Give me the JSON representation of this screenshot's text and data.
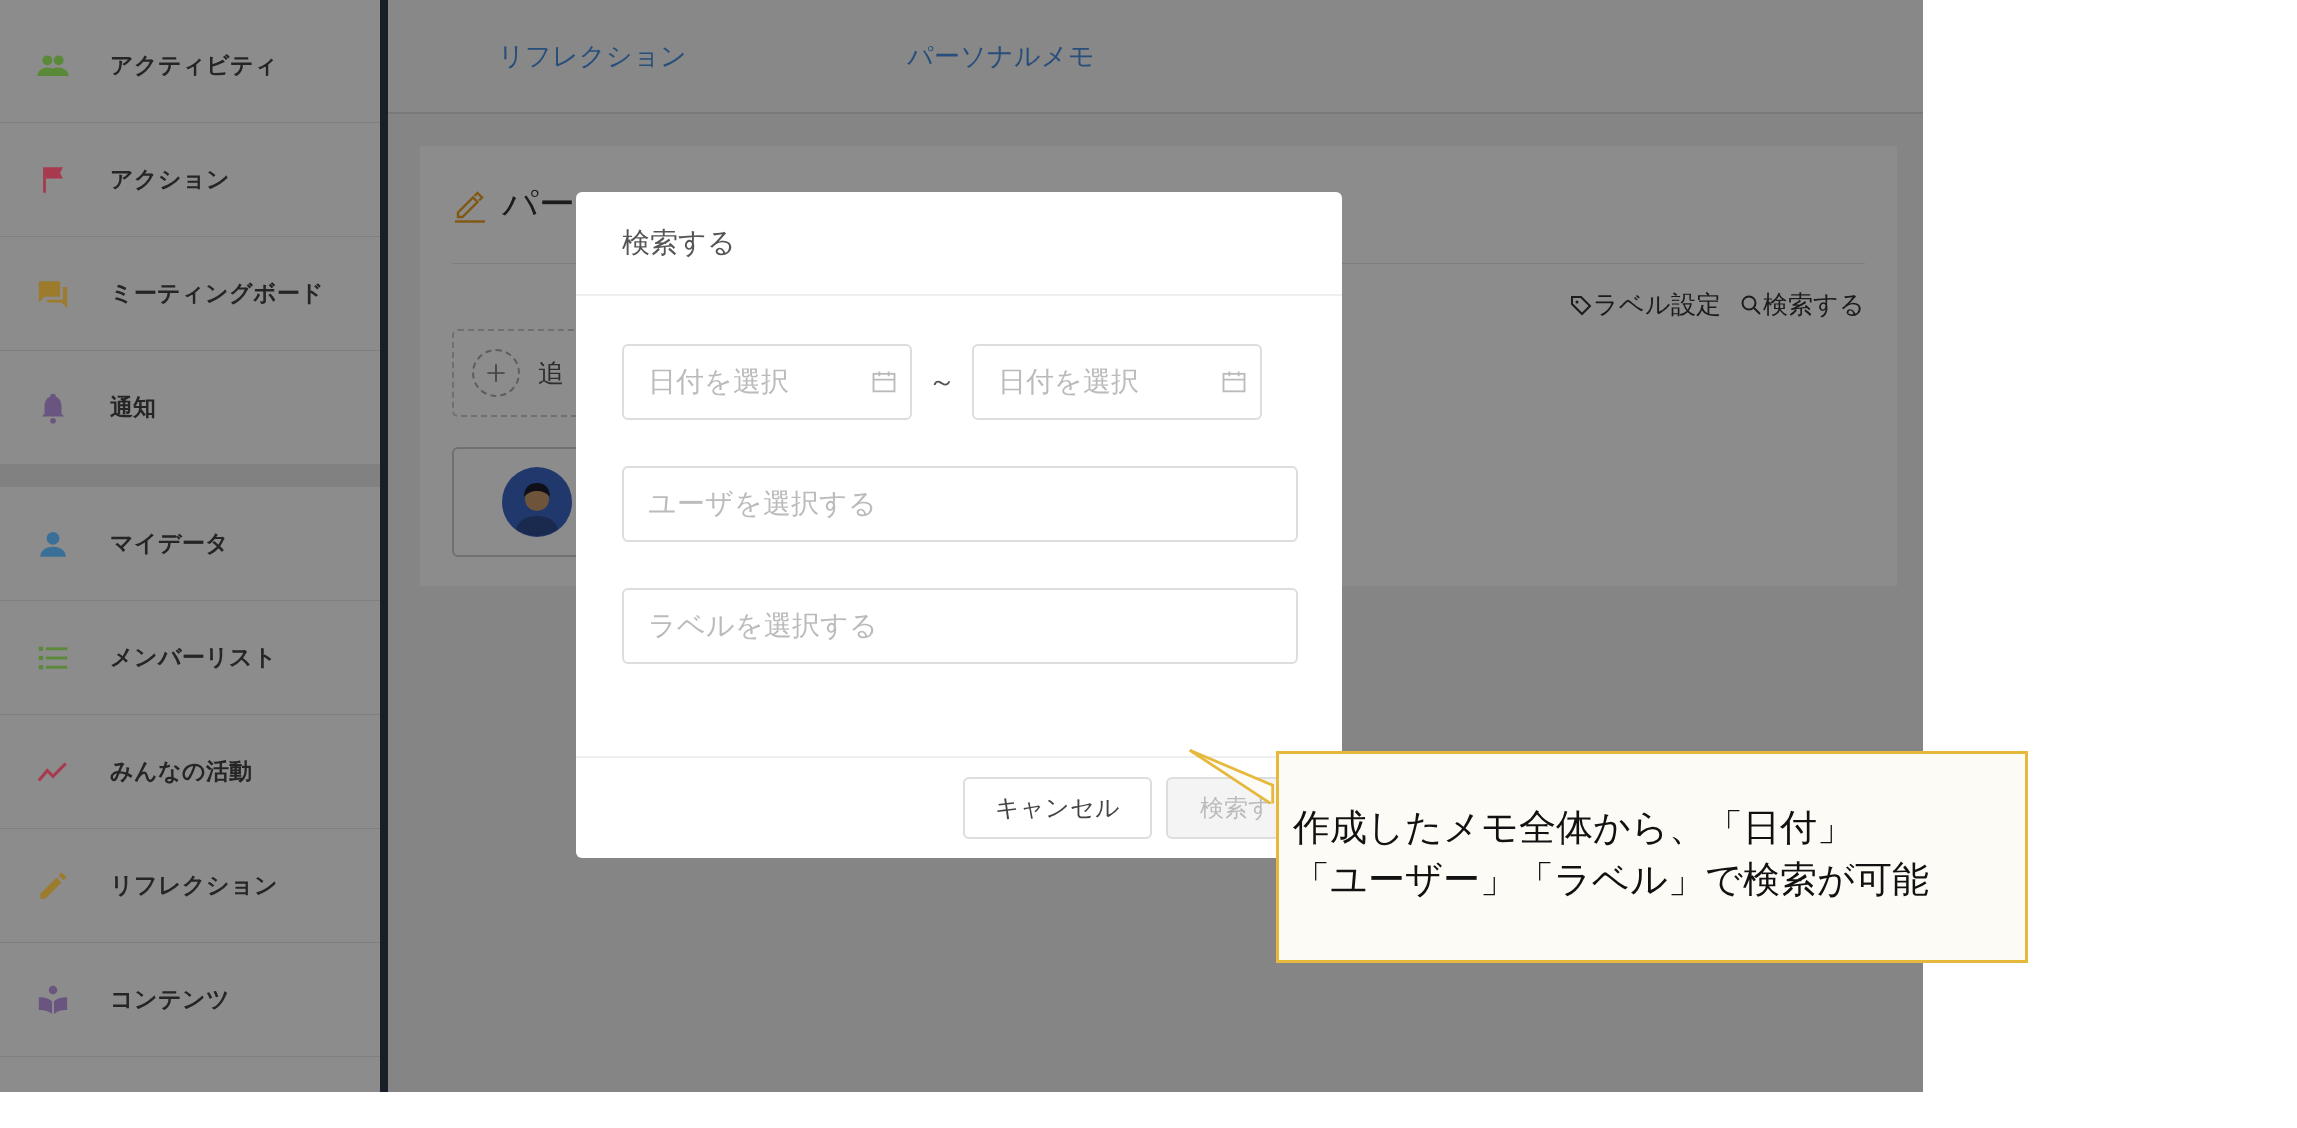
{
  "sidebar": {
    "groups": [
      {
        "items": [
          {
            "label": "アクティビティ",
            "kind": "people",
            "color": "#5a8a38"
          },
          {
            "label": "アクション",
            "kind": "flag",
            "color": "#a83a50"
          },
          {
            "label": "ミーティングボード",
            "kind": "chat",
            "color": "#9c7c2c"
          },
          {
            "label": "通知",
            "kind": "bell",
            "color": "#6a5480"
          }
        ]
      },
      {
        "items": [
          {
            "label": "マイデータ",
            "kind": "person",
            "color": "#3a7098"
          },
          {
            "label": "メンバーリスト",
            "kind": "list",
            "color": "#5a8a38"
          },
          {
            "label": "みんなの活動",
            "kind": "trend",
            "color": "#a83a50"
          },
          {
            "label": "リフレクション",
            "kind": "pencil",
            "color": "#9c7c2c"
          },
          {
            "label": "コンテンツ",
            "kind": "book",
            "color": "#6a5480"
          }
        ]
      }
    ]
  },
  "tabs": [
    {
      "label": "リフレクション"
    },
    {
      "label": "パーソナルメモ"
    }
  ],
  "panel": {
    "title": "パー",
    "tools": [
      {
        "label": "ラベル設定",
        "kind": "tag"
      },
      {
        "label": "検索する",
        "kind": "search"
      }
    ],
    "add_button": "追"
  },
  "dialog": {
    "title": "検索する",
    "date_from": {
      "placeholder": "日付を選択"
    },
    "range_sep": "～",
    "date_to": {
      "placeholder": "日付を選択"
    },
    "user": {
      "placeholder": "ユーザを選択する"
    },
    "label": {
      "placeholder": "ラベルを選択する"
    },
    "buttons": [
      {
        "label": "キャンセル",
        "disabled": false
      },
      {
        "label": "検索す",
        "disabled": true
      }
    ]
  },
  "callout": {
    "lines": [
      "作成したメモ全体から、「日付」",
      "「ユーザー」「ラベル」で検索が可能"
    ]
  }
}
